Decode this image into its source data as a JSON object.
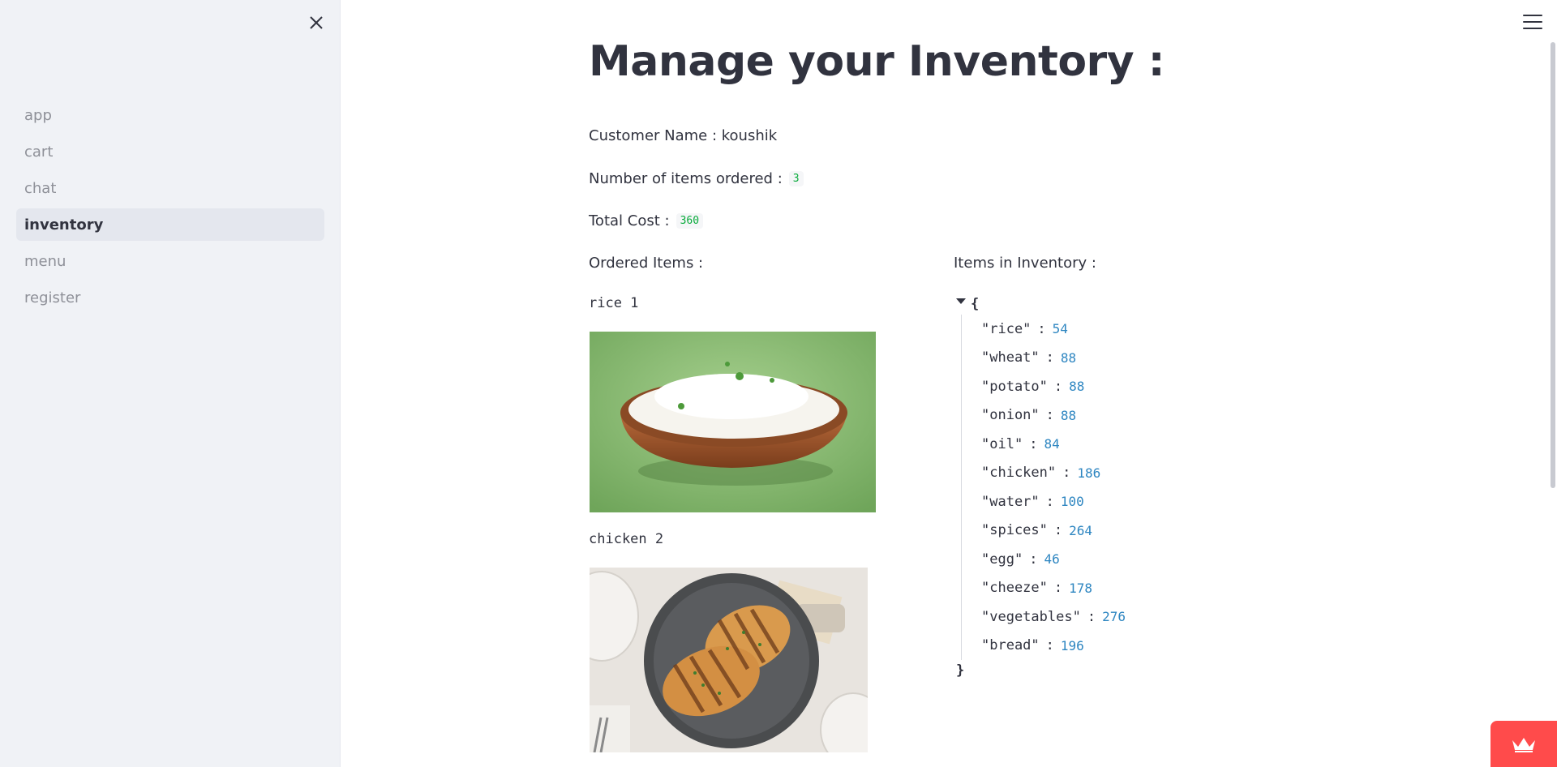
{
  "sidebar": {
    "nav_items": [
      {
        "label": "app",
        "active": false
      },
      {
        "label": "cart",
        "active": false
      },
      {
        "label": "chat",
        "active": false
      },
      {
        "label": "inventory",
        "active": true
      },
      {
        "label": "menu",
        "active": false
      },
      {
        "label": "register",
        "active": false
      }
    ]
  },
  "main": {
    "title": "Manage your Inventory :",
    "customer_label": "Customer Name : koushik",
    "items_ordered_label": "Number of items ordered :",
    "items_ordered_value": "3",
    "total_cost_label": "Total Cost :",
    "total_cost_value": "360",
    "ordered_items_label": "Ordered Items :",
    "inventory_label": "Items in Inventory :",
    "ordered_items": [
      {
        "text": "rice 1",
        "image": "rice-bowl"
      },
      {
        "text": "chicken 2",
        "image": "grilled-chicken-plate"
      }
    ],
    "inventory_json": {
      "open_brace": "{",
      "close_brace": "}",
      "entries": [
        {
          "key": "\"rice\"",
          "value": "54"
        },
        {
          "key": "\"wheat\"",
          "value": "88"
        },
        {
          "key": "\"potato\"",
          "value": "88"
        },
        {
          "key": "\"onion\"",
          "value": "88"
        },
        {
          "key": "\"oil\"",
          "value": "84"
        },
        {
          "key": "\"chicken\"",
          "value": "186"
        },
        {
          "key": "\"water\"",
          "value": "100"
        },
        {
          "key": "\"spices\"",
          "value": "264"
        },
        {
          "key": "\"egg\"",
          "value": "46"
        },
        {
          "key": "\"cheeze\"",
          "value": "178"
        },
        {
          "key": "\"vegetables\"",
          "value": "276"
        },
        {
          "key": "\"bread\"",
          "value": "196"
        }
      ]
    }
  },
  "icons": {
    "close": "close-icon",
    "menu": "hamburger-menu-icon",
    "collapse": "caret-down-icon",
    "badge": "crown-icon"
  },
  "colors": {
    "sidebar_bg": "#f0f2f6",
    "active_item_bg": "#e4e7ee",
    "code_green": "#09ab3b",
    "json_number": "#2e86c1",
    "badge_red": "#ff4b4b"
  }
}
